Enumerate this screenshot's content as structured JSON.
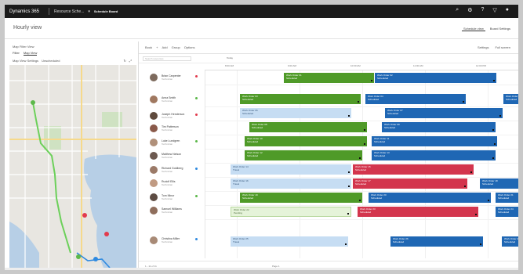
{
  "topbar": {
    "brand": "Dynamics 365",
    "app": "Resource Sche...",
    "page": "Schedule Board"
  },
  "header": {
    "title": "Hourly view",
    "right_tab": "Schedule view",
    "right_other": "Board Settings"
  },
  "map_pane": {
    "title": "Map Filter View",
    "tabs": [
      "Filter",
      "Map View"
    ],
    "selected_tab": "Map View",
    "row3": [
      "Map View Settings",
      "Unscheduled"
    ]
  },
  "toolbar": {
    "items": [
      "Book",
      "+",
      "Add",
      "Group",
      "Options"
    ],
    "right": [
      "Settings",
      "Full screen"
    ]
  },
  "filter": {
    "placeholder": "Search resources",
    "date": "Today"
  },
  "timeline": [
    "8:00 AM",
    "9:00 AM",
    "10:00 AM",
    "11:00 AM",
    "12:00 PM"
  ],
  "resources": [
    {
      "name": "Brian Carpenter",
      "sub": "Technician"
    },
    {
      "name": "Anna Smith",
      "sub": "Technician"
    },
    {
      "name": "Joseph Henderson",
      "sub": "Technician"
    },
    {
      "name": "Tim Patterson",
      "sub": "Technician"
    },
    {
      "name": "Luke Lundgren",
      "sub": "Technician"
    },
    {
      "name": "Matthew Nelson",
      "sub": "Technician"
    },
    {
      "name": "Richard Goldberg",
      "sub": "Technician"
    },
    {
      "name": "Rudolf Ellis",
      "sub": "Technician"
    },
    {
      "name": "Tom Minor",
      "sub": "Technician"
    },
    {
      "name": "Samuel Williams",
      "sub": "Technician"
    },
    {
      "name": "Christina Miller",
      "sub": "Technician"
    }
  ],
  "bookings": [
    {
      "title": "Work Order 01",
      "sub": "Scheduled",
      "color": "green"
    },
    {
      "title": "Work Order 02",
      "sub": "Scheduled",
      "color": "blue"
    },
    {
      "title": "Work Order 03",
      "sub": "Scheduled",
      "color": "green"
    },
    {
      "title": "Work Order 04",
      "sub": "Scheduled",
      "color": "blue"
    },
    {
      "title": "Work Order 05",
      "sub": "Scheduled",
      "color": "blue"
    },
    {
      "title": "Work Order 06",
      "sub": "Scheduled",
      "color": "lightblue"
    },
    {
      "title": "Work Order 07",
      "sub": "Scheduled",
      "color": "blue"
    },
    {
      "title": "Work Order 08",
      "sub": "Scheduled",
      "color": "green"
    },
    {
      "title": "Work Order 09",
      "sub": "Scheduled",
      "color": "blue"
    },
    {
      "title": "Work Order 10",
      "sub": "Scheduled",
      "color": "green"
    },
    {
      "title": "Work Order 11",
      "sub": "Scheduled",
      "color": "blue"
    },
    {
      "title": "Work Order 12",
      "sub": "Scheduled",
      "color": "green"
    },
    {
      "title": "Work Order 13",
      "sub": "Scheduled",
      "color": "blue"
    },
    {
      "title": "Work Order 14",
      "sub": "Travel",
      "color": "lightblue"
    },
    {
      "title": "Work Order 15",
      "sub": "Scheduled",
      "color": "red"
    },
    {
      "title": "Work Order 16",
      "sub": "Travel",
      "color": "lightblue"
    },
    {
      "title": "Work Order 17",
      "sub": "Scheduled",
      "color": "red"
    },
    {
      "title": "Work Order 18",
      "sub": "Scheduled",
      "color": "blue"
    },
    {
      "title": "Work Order 19",
      "sub": "Scheduled",
      "color": "green"
    },
    {
      "title": "Work Order 20",
      "sub": "Scheduled",
      "color": "blue"
    },
    {
      "title": "Work Order 21",
      "sub": "Scheduled",
      "color": "blue"
    },
    {
      "title": "Work Order 22",
      "sub": "Pending",
      "color": "lightgreen"
    },
    {
      "title": "Work Order 23",
      "sub": "Scheduled",
      "color": "red"
    },
    {
      "title": "Work Order 24",
      "sub": "Scheduled",
      "color": "blue"
    },
    {
      "title": "Work Order 25",
      "sub": "Travel",
      "color": "lightblue"
    },
    {
      "title": "Work Order 26",
      "sub": "Scheduled",
      "color": "blue"
    },
    {
      "title": "Work Order 27",
      "sub": "Scheduled",
      "color": "blue"
    }
  ],
  "footer": {
    "left": "1 - 11 of 11",
    "center": "Page 1"
  },
  "colors": {
    "green": "#4f9a28",
    "blue": "#1f67b4",
    "red": "#d3354d",
    "lightblue": "#c6ddf3",
    "topbar": "#1b1b1b"
  },
  "icons": [
    "search-icon",
    "settings-icon",
    "help-icon",
    "user-icon",
    "filter-icon",
    "refresh-icon",
    "map-pin-icon"
  ]
}
